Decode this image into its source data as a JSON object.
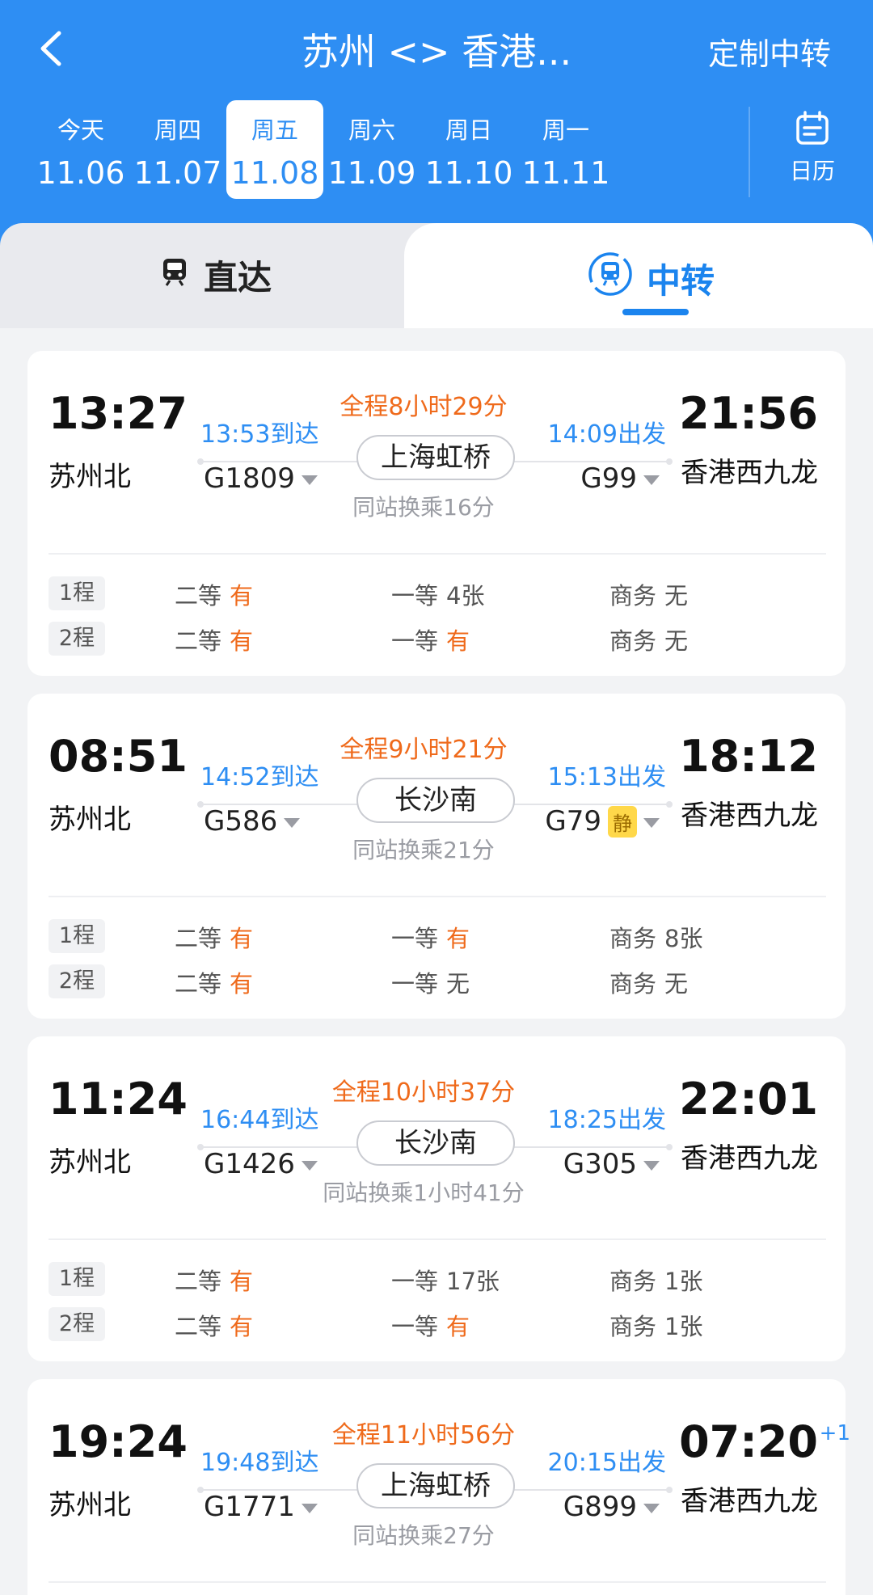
{
  "header": {
    "title": "苏州 <> 香港...",
    "custom_label": "定制中转",
    "calendar_label": "日历",
    "dates": [
      {
        "weekday": "今天",
        "date": "11.06",
        "active": false
      },
      {
        "weekday": "周四",
        "date": "11.07",
        "active": false
      },
      {
        "weekday": "周五",
        "date": "11.08",
        "active": true
      },
      {
        "weekday": "周六",
        "date": "11.09",
        "active": false
      },
      {
        "weekday": "周日",
        "date": "11.10",
        "active": false
      },
      {
        "weekday": "周一",
        "date": "11.11",
        "active": false
      }
    ]
  },
  "tabs": {
    "direct": "直达",
    "transfer": "中转"
  },
  "cards": [
    {
      "dep_time": "13:27",
      "dep_station": "苏州北",
      "arr_time": "21:56",
      "arr_station": "香港西九龙",
      "plus": "",
      "arrive1": "13:53到达",
      "depart2": "14:09出发",
      "total": "全程8小时29分",
      "via": "上海虹桥",
      "train1": "G1809",
      "train2": "G99",
      "quiet": "",
      "transfer_note": "同站换乘16分",
      "segments": [
        {
          "tag": "1程",
          "second_label": "二等",
          "second": "有",
          "first_label": "一等",
          "first": "4张",
          "business_label": "商务",
          "business": "无"
        },
        {
          "tag": "2程",
          "second_label": "二等",
          "second": "有",
          "first_label": "一等",
          "first": "有",
          "business_label": "商务",
          "business": "无"
        }
      ]
    },
    {
      "dep_time": "08:51",
      "dep_station": "苏州北",
      "arr_time": "18:12",
      "arr_station": "香港西九龙",
      "plus": "",
      "arrive1": "14:52到达",
      "depart2": "15:13出发",
      "total": "全程9小时21分",
      "via": "长沙南",
      "train1": "G586",
      "train2": "G79",
      "quiet": "静",
      "transfer_note": "同站换乘21分",
      "segments": [
        {
          "tag": "1程",
          "second_label": "二等",
          "second": "有",
          "first_label": "一等",
          "first": "有",
          "business_label": "商务",
          "business": "8张"
        },
        {
          "tag": "2程",
          "second_label": "二等",
          "second": "有",
          "first_label": "一等",
          "first": "无",
          "business_label": "商务",
          "business": "无"
        }
      ]
    },
    {
      "dep_time": "11:24",
      "dep_station": "苏州北",
      "arr_time": "22:01",
      "arr_station": "香港西九龙",
      "plus": "",
      "arrive1": "16:44到达",
      "depart2": "18:25出发",
      "total": "全程10小时37分",
      "via": "长沙南",
      "train1": "G1426",
      "train2": "G305",
      "quiet": "",
      "transfer_note": "同站换乘1小时41分",
      "segments": [
        {
          "tag": "1程",
          "second_label": "二等",
          "second": "有",
          "first_label": "一等",
          "first": "17张",
          "business_label": "商务",
          "business": "1张"
        },
        {
          "tag": "2程",
          "second_label": "二等",
          "second": "有",
          "first_label": "一等",
          "first": "有",
          "business_label": "商务",
          "business": "1张"
        }
      ]
    },
    {
      "dep_time": "19:24",
      "dep_station": "苏州北",
      "arr_time": "07:20",
      "arr_station": "香港西九龙",
      "plus": "+1",
      "arrive1": "19:48到达",
      "depart2": "20:15出发",
      "total": "全程11小时56分",
      "via": "上海虹桥",
      "train1": "G1771",
      "train2": "G899",
      "quiet": "",
      "transfer_note": "同站换乘27分",
      "segments": []
    }
  ],
  "colors": {
    "brand": "#2e8ef3",
    "accent_orange": "#ef6a1b",
    "quiet_badge": "#ffd84a"
  }
}
